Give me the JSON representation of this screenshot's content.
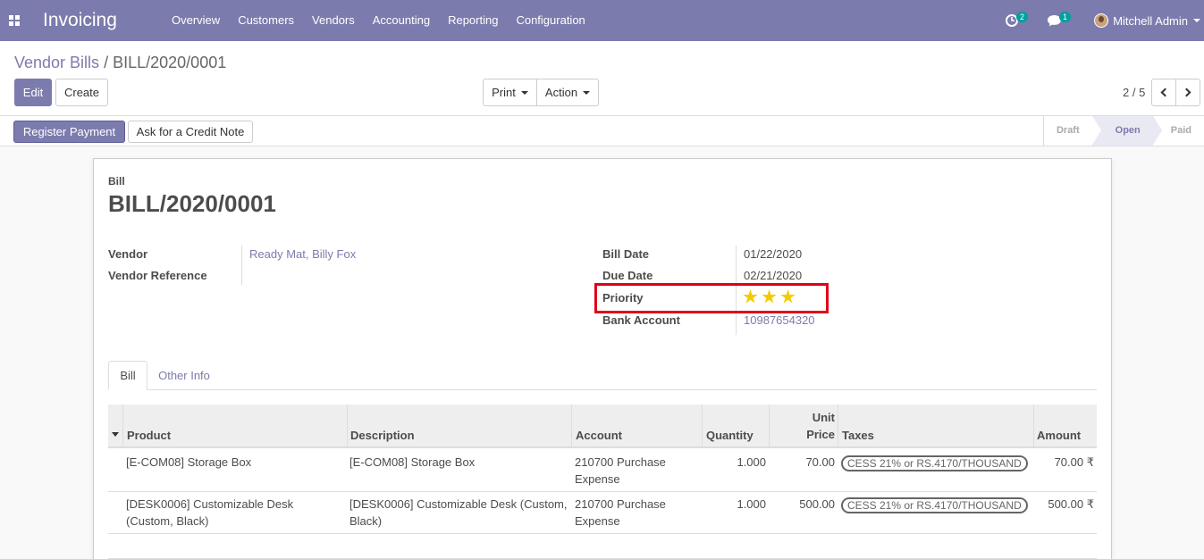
{
  "navbar": {
    "app_name": "Invoicing",
    "menu": [
      "Overview",
      "Customers",
      "Vendors",
      "Accounting",
      "Reporting",
      "Configuration"
    ],
    "activity_count": "2",
    "message_count": "1",
    "user_name": "Mitchell Admin"
  },
  "breadcrumb": {
    "parent": "Vendor Bills",
    "separator": "/",
    "current": "BILL/2020/0001"
  },
  "toolbar": {
    "edit_label": "Edit",
    "create_label": "Create",
    "print_label": "Print",
    "action_label": "Action",
    "pager": "2 / 5"
  },
  "statusbar": {
    "register_payment_label": "Register Payment",
    "credit_note_label": "Ask for a Credit Note",
    "stages": [
      "Draft",
      "Open",
      "Paid"
    ],
    "active_stage": "Open"
  },
  "bill": {
    "type_label": "Bill",
    "number": "BILL/2020/0001",
    "vendor_label": "Vendor",
    "vendor_value": "Ready Mat, Billy Fox",
    "vendor_ref_label": "Vendor Reference",
    "vendor_ref_value": "",
    "bill_date_label": "Bill Date",
    "bill_date_value": "01/22/2020",
    "due_date_label": "Due Date",
    "due_date_value": "02/21/2020",
    "priority_label": "Priority",
    "priority_stars": 3,
    "priority_max": 3,
    "bank_account_label": "Bank Account",
    "bank_account_value": "10987654320"
  },
  "tabs": [
    "Bill",
    "Other Info"
  ],
  "table": {
    "headers": {
      "product": "Product",
      "description": "Description",
      "account": "Account",
      "quantity": "Quantity",
      "unit_price_1": "Unit",
      "unit_price_2": "Price",
      "taxes": "Taxes",
      "amount": "Amount"
    },
    "rows": [
      {
        "product_1": "[E-COM08] Storage Box",
        "product_2": "",
        "description_1": "[E-COM08] Storage Box",
        "description_2": "",
        "account_1": "210700 Purchase",
        "account_2": "Expense",
        "quantity": "1.000",
        "unit_price": "70.00",
        "tax": "CESS 21% or RS.4170/THOUSAND",
        "amount": "70.00 ₹"
      },
      {
        "product_1": "[DESK0006] Customizable Desk",
        "product_2": "(Custom, Black)",
        "description_1": "[DESK0006] Customizable Desk (Custom,",
        "description_2": "Black)",
        "account_1": "210700 Purchase",
        "account_2": "Expense",
        "quantity": "1.000",
        "unit_price": "500.00",
        "tax": "CESS 21% or RS.4170/THOUSAND",
        "amount": "500.00 ₹"
      }
    ]
  },
  "colors": {
    "brand": "#7c7bad",
    "highlight": "#e0001a",
    "star": "#f3cc00"
  }
}
